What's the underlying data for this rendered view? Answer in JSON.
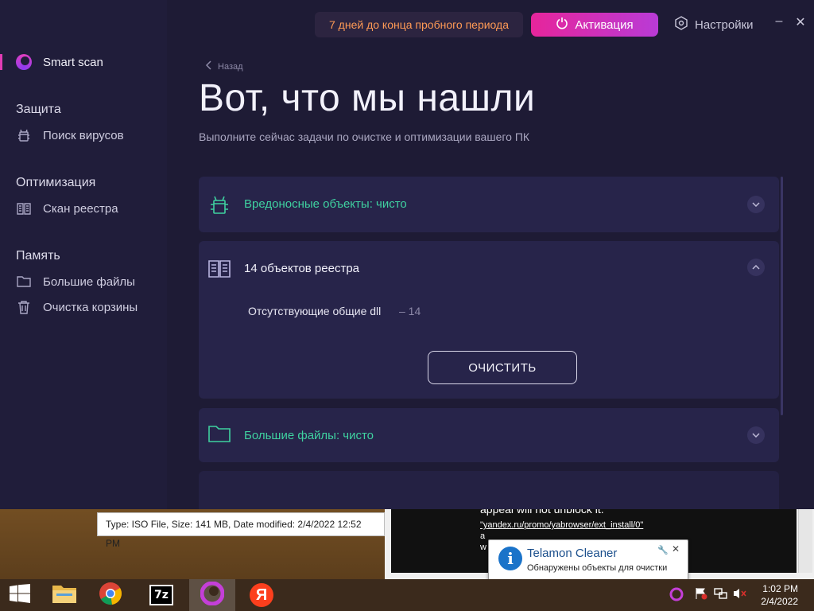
{
  "app": {
    "trial_text": "7 дней до конца пробного периода",
    "activate_label": "Активация",
    "settings_label": "Настройки",
    "back_label": "Назад",
    "page_title": "Вот, что мы нашли",
    "page_subtitle": "Выполните сейчас задачи по очистке и оптимизации вашего ПК"
  },
  "sidebar": {
    "smart_scan": "Smart scan",
    "section_protection": "Защита",
    "item_virus_search": "Поиск вирусов",
    "section_optimization": "Оптимизация",
    "item_registry_scan": "Скан реестра",
    "section_memory": "Память",
    "item_large_files": "Большие файлы",
    "item_recycle_bin": "Очистка корзины"
  },
  "results": {
    "malware_label": "Вредоносные объекты: чисто",
    "registry_label": "14 объектов реестра",
    "registry_detail_label": "Отсутствующие общие dll",
    "registry_detail_count": "– 14",
    "clean_button": "ОЧИСТИТЬ",
    "large_files_label": "Большие файлы: чисто"
  },
  "desktop": {
    "tooltip_text": "Type: ISO File, Size: 141 MB, Date modified: 2/4/2022 12:52 PM",
    "browser_line1": "appeal will not unblock it.",
    "browser_line2": "\"yandex.ru/promo/yabrowser/ext_install/0\"",
    "browser_line3_a": "a",
    "browser_line3_w": "w"
  },
  "notification": {
    "title": "Telamon Cleaner",
    "text": "Обнаружены объекты для очистки"
  },
  "taskbar": {
    "time": "1:02 PM",
    "date": "2/4/2022",
    "sevenzip_label": "7z",
    "yandex_label": "Я"
  },
  "colors": {
    "accent_pink": "#e6259b",
    "clean_green": "#3fd1a0",
    "trial_orange": "#ff9a55"
  }
}
